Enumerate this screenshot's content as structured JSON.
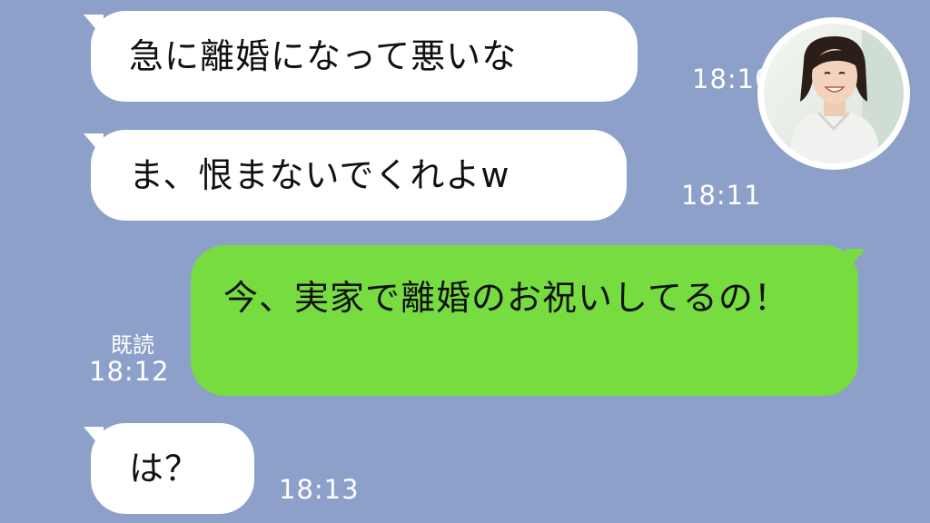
{
  "messages": [
    {
      "text": "急に離婚になって悪いな",
      "time": "18:10"
    },
    {
      "text": "ま、恨まないでくれよw",
      "time": "18:11"
    },
    {
      "text": "今、実家で離婚のお祝いしてるの！",
      "read": "既読",
      "time": "18:12"
    },
    {
      "text": "は？",
      "time": "18:13"
    }
  ],
  "colors": {
    "background": "#8da0c9",
    "received_bubble": "#ffffff",
    "sent_bubble": "#76dc3f"
  },
  "avatar": {
    "icon": "woman-portrait-avatar"
  }
}
